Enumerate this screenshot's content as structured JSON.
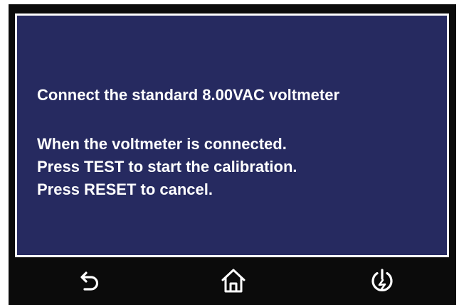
{
  "message": {
    "line1": "Connect the standard 8.00VAC voltmeter",
    "line2": "When the voltmeter is connected.",
    "line3": "Press TEST to start the calibration.",
    "line4": "Press RESET to cancel."
  },
  "navbar": {
    "back_icon": "back-arrow-icon",
    "home_icon": "home-icon",
    "power_icon": "power-icon"
  },
  "colors": {
    "screen_background": "#262a60",
    "bezel": "#0b0b0b",
    "text": "#ffffff"
  }
}
